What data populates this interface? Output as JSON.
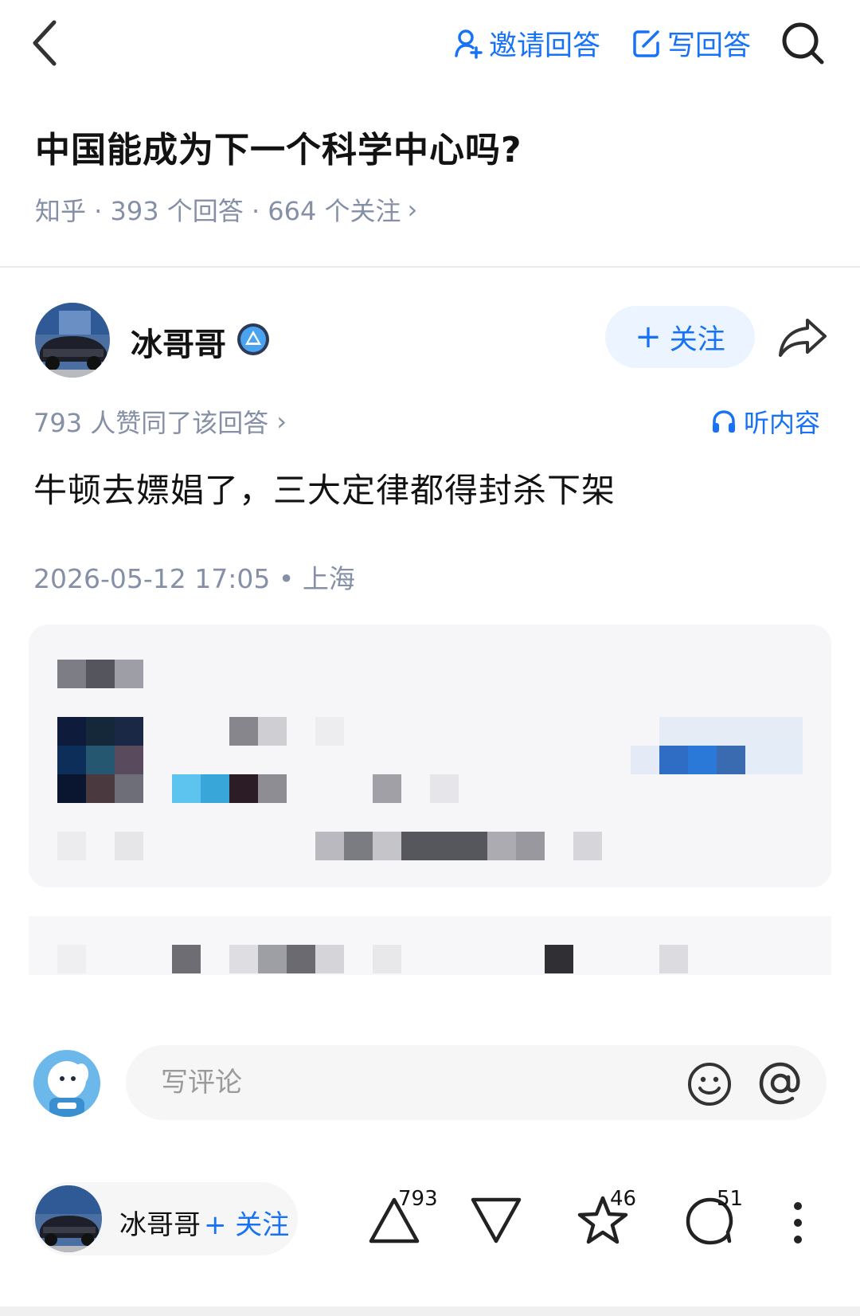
{
  "topbar": {
    "back_icon": "chevron-left-icon",
    "invite_label": "邀请回答",
    "write_label": "写回答",
    "search_icon": "search-icon",
    "accent": "#1772f6"
  },
  "question": {
    "title": "中国能成为下一个科学中心吗?",
    "meta": "知乎 · 393 个回答 · 664 个关注",
    "meta_arrow": "›"
  },
  "author": {
    "name": "冰哥哥",
    "follow_label": "关注",
    "follow_plus": "+"
  },
  "answer": {
    "vote_summary": "793 人赞同了该回答",
    "vote_arrow": "›",
    "listen_label": "听内容",
    "text": "牛顿去嫖娼了，三大定律都得封杀下架",
    "time_location": "2026-05-12 17:05 • 上海"
  },
  "comment": {
    "placeholder": "写评论",
    "emoji_icon": "smile-icon",
    "at_icon": "at-icon"
  },
  "bottom_bar": {
    "author_name": "冰哥哥",
    "follow_label": "+ 关注",
    "upvote_count": "793",
    "favorite_count": "46",
    "comment_count": "51"
  }
}
